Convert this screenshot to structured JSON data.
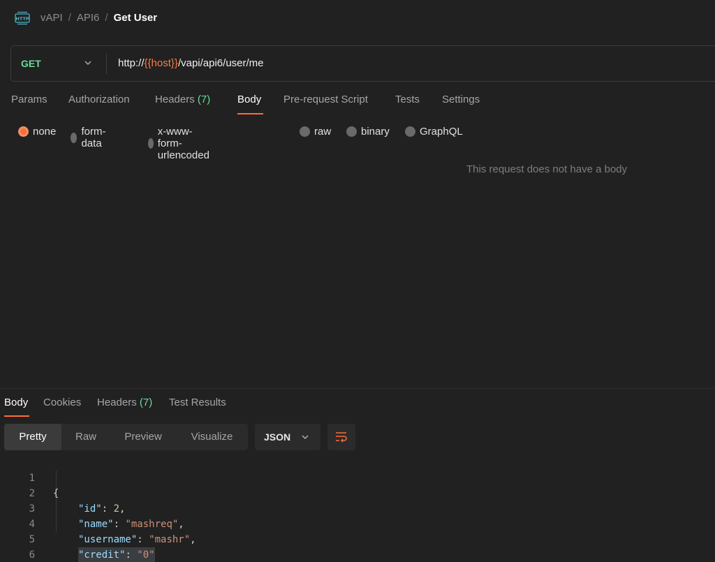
{
  "breadcrumb": {
    "icon": "http-icon",
    "items": [
      "vAPI",
      "API6"
    ],
    "current": "Get User"
  },
  "request": {
    "method": "GET",
    "url_prefix": "http://",
    "url_variable": "{{host}}",
    "url_suffix": "/vapi/api6/user/me"
  },
  "request_tabs": {
    "params": "Params",
    "authorization": "Authorization",
    "headers": "Headers",
    "headers_count": "(7)",
    "body": "Body",
    "pre_request": "Pre-request Script",
    "tests": "Tests",
    "settings": "Settings",
    "active": "Body"
  },
  "body_types": {
    "none": "none",
    "form_data": "form-data",
    "urlencoded": "x-www-form-urlencoded",
    "raw": "raw",
    "binary": "binary",
    "graphql": "GraphQL",
    "selected": "none"
  },
  "empty_message": "This request does not have a body",
  "response_tabs": {
    "body": "Body",
    "cookies": "Cookies",
    "headers": "Headers",
    "headers_count": "(7)",
    "test_results": "Test Results",
    "active": "Body"
  },
  "view_modes": {
    "pretty": "Pretty",
    "raw": "Raw",
    "preview": "Preview",
    "visualize": "Visualize",
    "active": "Pretty"
  },
  "format": "JSON",
  "response_lines": {
    "numbers": [
      "1",
      "2",
      "3",
      "4",
      "5",
      "6"
    ],
    "open_brace": "{",
    "close_brace": "}",
    "fields": [
      {
        "key": "\"id\"",
        "value": "2",
        "type": "number",
        "trailing": ","
      },
      {
        "key": "\"name\"",
        "value": "\"mashreq\"",
        "type": "string",
        "trailing": ","
      },
      {
        "key": "\"username\"",
        "value": "\"mashr\"",
        "type": "string",
        "trailing": ","
      },
      {
        "key": "\"credit\"",
        "value": "\"0\"",
        "type": "string",
        "trailing": ""
      }
    ]
  },
  "colors": {
    "accent": "#ff6c37",
    "method_get": "#6bdd9a",
    "count": "#6bdd9a",
    "json_key": "#9cdcfe",
    "json_string": "#ce9178",
    "json_number": "#b5cea8"
  }
}
